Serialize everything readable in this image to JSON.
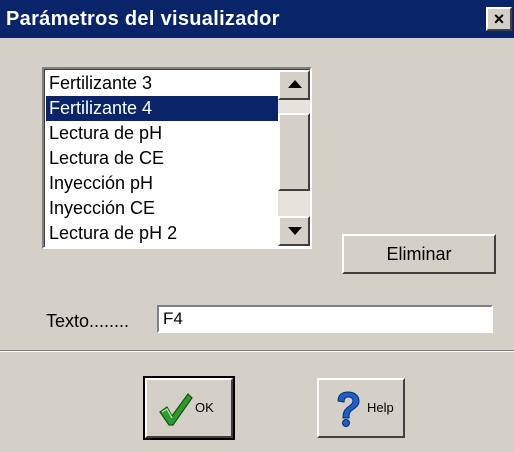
{
  "window": {
    "title": "Parámetros del visualizador",
    "close_glyph": "×"
  },
  "list": {
    "items": [
      {
        "label": "Fertilizante 3",
        "selected": false
      },
      {
        "label": "Fertilizante 4",
        "selected": true
      },
      {
        "label": "Lectura de pH",
        "selected": false
      },
      {
        "label": "Lectura de CE",
        "selected": false
      },
      {
        "label": "Inyección pH",
        "selected": false
      },
      {
        "label": "Inyección CE",
        "selected": false
      },
      {
        "label": "Lectura de pH 2",
        "selected": false
      }
    ]
  },
  "actions": {
    "delete_label": "Eliminar",
    "ok_label": "OK",
    "help_label": "Help",
    "ok_icon": "checkmark-icon",
    "help_icon": "question-mark-icon"
  },
  "text_field": {
    "label": "Texto........",
    "value": "F4"
  },
  "colors": {
    "titlebar": "#0a246a",
    "selection": "#0a246a",
    "face": "#d4d0c8",
    "check_green": "#2e9a2e",
    "help_blue": "#1c5fc8"
  }
}
